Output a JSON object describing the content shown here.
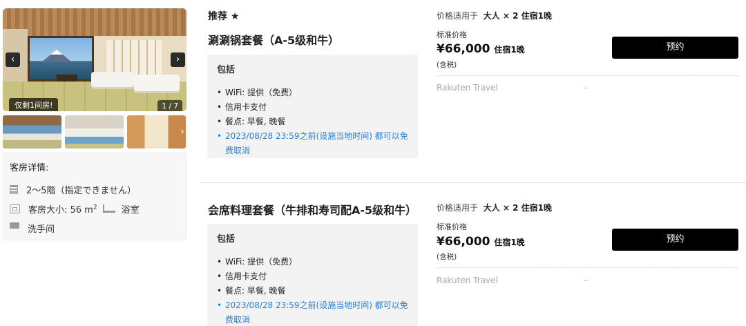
{
  "gallery": {
    "prev_icon": "‹",
    "next_icon": "›",
    "rooms_left": "仅剩1间房!",
    "page_indicator": "1 / 7",
    "thumb_next_icon": "›"
  },
  "room_details": {
    "title": "客房详情:",
    "floor": "2〜5階（指定できません）",
    "size_prefix": "客房大小: 56 m",
    "size_sup": "2",
    "bath": "浴室",
    "toilet": "洗手间"
  },
  "plans": [
    {
      "badge": "推荐 ★",
      "name": "涮涮锅套餐（A-5级和牛）",
      "includes_title": "包括",
      "includes": [
        "WiFi: 提供（免费）",
        "信用卡支付",
        "餐点: 早餐, 晚餐"
      ],
      "cancellation": "2023/08/28 23:59之前(设施当地时间) 都可以免费取消",
      "price_applies_prefix": "价格适用于",
      "price_applies_value": "大人 × 2 住宿1晚",
      "price_label": "标准价格",
      "price": "¥66,000",
      "per_night": "住宿1晚",
      "tax_note": "(含税)",
      "book_label": "预约",
      "provider": "Rakuten Travel",
      "provider_value": "-"
    },
    {
      "name": "会席料理套餐（牛排和寿司配A-5级和牛）",
      "includes_title": "包括",
      "includes": [
        "WiFi: 提供（免费）",
        "信用卡支付",
        "餐点: 早餐, 晚餐"
      ],
      "cancellation": "2023/08/28 23:59之前(设施当地时间) 都可以免费取消",
      "price_applies_prefix": "价格适用于",
      "price_applies_value": "大人 × 2 住宿1晚",
      "price_label": "标准价格",
      "price": "¥66,000",
      "per_night": "住宿1晚",
      "tax_note": "(含税)",
      "book_label": "预约",
      "provider": "Rakuten Travel",
      "provider_value": "-"
    }
  ]
}
